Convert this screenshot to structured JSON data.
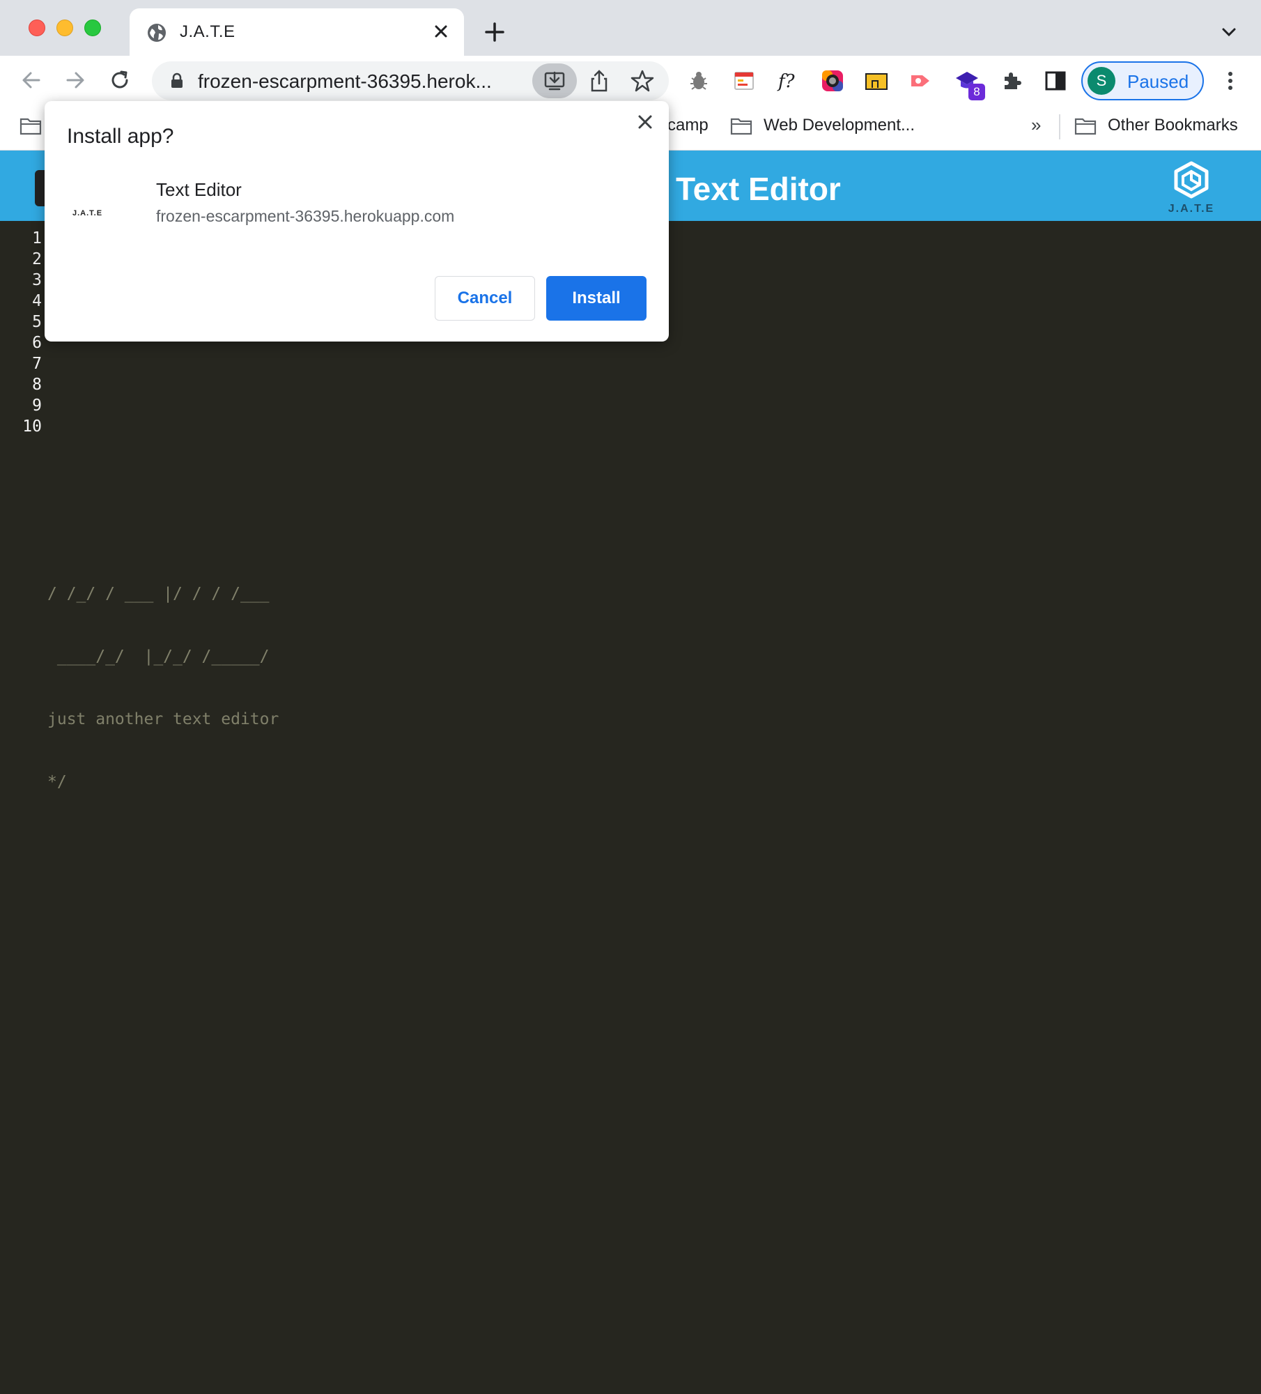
{
  "browser": {
    "tab": {
      "title": "J.A.T.E"
    },
    "address_bar": {
      "url": "frozen-escarpment-36395.herok..."
    },
    "profile": {
      "initial": "S",
      "status": "Paused"
    },
    "extension_badge": "8",
    "bookmarks": [
      {
        "label": "camp"
      },
      {
        "label": "Web Development..."
      }
    ],
    "bookmarks_overflow": "»",
    "other_bookmarks": "Other Bookmarks",
    "colors": {
      "accent": "#1a73e8",
      "tab_strip": "#dee1e6"
    }
  },
  "app": {
    "header_title": "Text Editor",
    "logo_text": "J.A.T.E",
    "colors": {
      "header": "#31a9e1",
      "editor_bg": "#26261f"
    }
  },
  "editor": {
    "line_numbers": [
      "1",
      "2",
      "3",
      "4",
      "5",
      "6",
      "7",
      "8",
      "9",
      "10"
    ],
    "lines": [
      "",
      "",
      "",
      "",
      "",
      "/ /_/ / ___ |/ / / /___",
      " ____/_/  |_/_/ /_____/",
      "just another text editor",
      "*/",
      ""
    ]
  },
  "install_dialog": {
    "title": "Install app?",
    "app_name": "Text Editor",
    "app_origin": "frozen-escarpment-36395.herokuapp.com",
    "app_icon_text": "J.A.T.E",
    "cancel_label": "Cancel",
    "install_label": "Install"
  }
}
